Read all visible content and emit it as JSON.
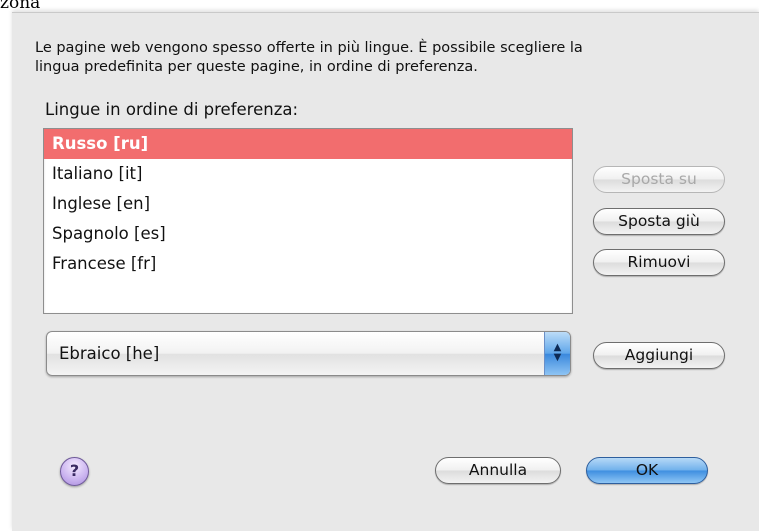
{
  "background_window": {
    "title_fragment": "zona"
  },
  "dialog": {
    "description_line1": "Le pagine web vengono spesso offerte in più lingue. È possibile scegliere la",
    "description_line2": "lingua predefinita per queste pagine, in ordine di preferenza.",
    "list_label": "Lingue in ordine di preferenza:",
    "languages": [
      {
        "label": "Russo  [ru]",
        "selected": true
      },
      {
        "label": "Italiano  [it]",
        "selected": false
      },
      {
        "label": "Inglese  [en]",
        "selected": false
      },
      {
        "label": "Spagnolo  [es]",
        "selected": false
      },
      {
        "label": "Francese  [fr]",
        "selected": false
      }
    ],
    "buttons": {
      "move_up": "Sposta su",
      "move_down": "Sposta giù",
      "remove": "Rimuovi",
      "add": "Aggiungi",
      "cancel": "Annulla",
      "ok": "OK",
      "help": "?"
    },
    "add_popup": {
      "selected_value": "Ebraico  [he]"
    },
    "colors": {
      "selection": "#f26d6e",
      "default_button": "#3e8ee0",
      "sheet_background": "#e8e8e8"
    }
  }
}
